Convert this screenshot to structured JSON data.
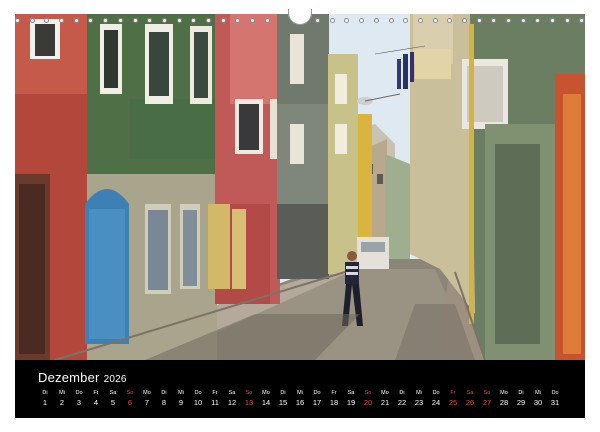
{
  "calendar": {
    "month": "Dezember",
    "year": "2026",
    "holiday_color": "#e05050",
    "days": [
      {
        "wd": "Di",
        "dn": "1"
      },
      {
        "wd": "Mi",
        "dn": "2"
      },
      {
        "wd": "Do",
        "dn": "3"
      },
      {
        "wd": "Fr",
        "dn": "4"
      },
      {
        "wd": "Sa",
        "dn": "5"
      },
      {
        "wd": "So",
        "dn": "6",
        "holiday": true
      },
      {
        "wd": "Mo",
        "dn": "7"
      },
      {
        "wd": "Di",
        "dn": "8"
      },
      {
        "wd": "Mi",
        "dn": "9"
      },
      {
        "wd": "Do",
        "dn": "10"
      },
      {
        "wd": "Fr",
        "dn": "11"
      },
      {
        "wd": "Sa",
        "dn": "12"
      },
      {
        "wd": "So",
        "dn": "13",
        "holiday": true
      },
      {
        "wd": "Mo",
        "dn": "14"
      },
      {
        "wd": "Di",
        "dn": "15"
      },
      {
        "wd": "Mi",
        "dn": "16"
      },
      {
        "wd": "Do",
        "dn": "17"
      },
      {
        "wd": "Fr",
        "dn": "18"
      },
      {
        "wd": "Sa",
        "dn": "19"
      },
      {
        "wd": "So",
        "dn": "20",
        "holiday": true
      },
      {
        "wd": "Mo",
        "dn": "21"
      },
      {
        "wd": "Di",
        "dn": "22"
      },
      {
        "wd": "Mi",
        "dn": "23"
      },
      {
        "wd": "Do",
        "dn": "24"
      },
      {
        "wd": "Fr",
        "dn": "25",
        "holiday": true
      },
      {
        "wd": "Sa",
        "dn": "26",
        "holiday": true
      },
      {
        "wd": "So",
        "dn": "27",
        "holiday": true
      },
      {
        "wd": "Mo",
        "dn": "28"
      },
      {
        "wd": "Di",
        "dn": "29"
      },
      {
        "wd": "Mi",
        "dn": "30"
      },
      {
        "wd": "Do",
        "dn": "31"
      }
    ]
  },
  "photo": {
    "icon": "street-photo",
    "colors": {
      "sky": "#e6edf2",
      "red_house": "#b8493c",
      "green_house": "#5f7552",
      "pink_house": "#c25a5a",
      "yellow_house": "#d9b24a",
      "right_wall": "#6a7d62",
      "street": "#8a8478",
      "blue_door": "#3d7fb0"
    }
  }
}
